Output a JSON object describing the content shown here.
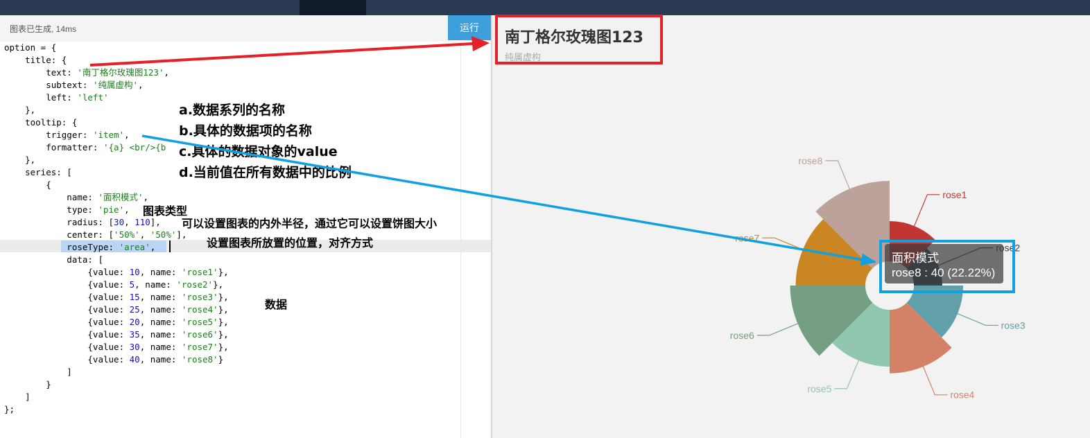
{
  "status": {
    "message": "图表已生成, 14ms"
  },
  "toolbar": {
    "run_label": "运行"
  },
  "code_lines": [
    [
      {
        "t": "option = {"
      }
    ],
    [
      {
        "t": "    title: {"
      }
    ],
    [
      {
        "t": "        text: "
      },
      {
        "t": "'南丁格尔玫瑰图123'",
        "c": "s"
      },
      {
        "t": ","
      }
    ],
    [
      {
        "t": "        subtext: "
      },
      {
        "t": "'纯属虚构'",
        "c": "s"
      },
      {
        "t": ","
      }
    ],
    [
      {
        "t": "        left: "
      },
      {
        "t": "'left'",
        "c": "s"
      }
    ],
    [
      {
        "t": "    },"
      }
    ],
    [
      {
        "t": "    tooltip: {"
      }
    ],
    [
      {
        "t": "        trigger: "
      },
      {
        "t": "'item'",
        "c": "s"
      },
      {
        "t": ","
      }
    ],
    [
      {
        "t": "        formatter: "
      },
      {
        "t": "'{a} <br/>{b",
        "c": "s"
      }
    ],
    [
      {
        "t": "    },"
      }
    ],
    [
      {
        "t": "    series: ["
      }
    ],
    [
      {
        "t": "        {"
      }
    ],
    [
      {
        "t": "            name: "
      },
      {
        "t": "'面积模式'",
        "c": "s"
      },
      {
        "t": ","
      }
    ],
    [
      {
        "t": "            type: "
      },
      {
        "t": "'pie'",
        "c": "s"
      },
      {
        "t": ","
      }
    ],
    [
      {
        "t": "            radius: ["
      },
      {
        "t": "30",
        "c": "n"
      },
      {
        "t": ", "
      },
      {
        "t": "110",
        "c": "n"
      },
      {
        "t": "],"
      }
    ],
    [
      {
        "t": "            center: ["
      },
      {
        "t": "'50%'",
        "c": "s"
      },
      {
        "t": ", "
      },
      {
        "t": "'50%'",
        "c": "s"
      },
      {
        "t": "],"
      }
    ],
    [
      {
        "t": "            roseType: "
      },
      {
        "t": "'area'",
        "c": "s"
      },
      {
        "t": ","
      }
    ],
    [
      {
        "t": "            data: ["
      }
    ],
    [
      {
        "t": "                {value: "
      },
      {
        "t": "10",
        "c": "n"
      },
      {
        "t": ", name: "
      },
      {
        "t": "'rose1'",
        "c": "s"
      },
      {
        "t": "},"
      }
    ],
    [
      {
        "t": "                {value: "
      },
      {
        "t": "5",
        "c": "n"
      },
      {
        "t": ", name: "
      },
      {
        "t": "'rose2'",
        "c": "s"
      },
      {
        "t": "},"
      }
    ],
    [
      {
        "t": "                {value: "
      },
      {
        "t": "15",
        "c": "n"
      },
      {
        "t": ", name: "
      },
      {
        "t": "'rose3'",
        "c": "s"
      },
      {
        "t": "},"
      }
    ],
    [
      {
        "t": "                {value: "
      },
      {
        "t": "25",
        "c": "n"
      },
      {
        "t": ", name: "
      },
      {
        "t": "'rose4'",
        "c": "s"
      },
      {
        "t": "},"
      }
    ],
    [
      {
        "t": "                {value: "
      },
      {
        "t": "20",
        "c": "n"
      },
      {
        "t": ", name: "
      },
      {
        "t": "'rose5'",
        "c": "s"
      },
      {
        "t": "},"
      }
    ],
    [
      {
        "t": "                {value: "
      },
      {
        "t": "35",
        "c": "n"
      },
      {
        "t": ", name: "
      },
      {
        "t": "'rose6'",
        "c": "s"
      },
      {
        "t": "},"
      }
    ],
    [
      {
        "t": "                {value: "
      },
      {
        "t": "30",
        "c": "n"
      },
      {
        "t": ", name: "
      },
      {
        "t": "'rose7'",
        "c": "s"
      },
      {
        "t": "},"
      }
    ],
    [
      {
        "t": "                {value: "
      },
      {
        "t": "40",
        "c": "n"
      },
      {
        "t": ", name: "
      },
      {
        "t": "'rose8'",
        "c": "s"
      },
      {
        "t": "}"
      }
    ],
    [
      {
        "t": "            ]"
      }
    ],
    [
      {
        "t": "        }"
      }
    ],
    [
      {
        "t": "    ]"
      }
    ],
    [
      {
        "t": "};"
      }
    ]
  ],
  "annotations": {
    "a": "a.数据系列的名称",
    "b": "b.具体的数据项的名称",
    "c": "c.具体的数据对象的value",
    "d": "d.当前值在所有数据中的比例",
    "type": "图表类型",
    "radius": "可以设置图表的内外半径，通过它可以设置饼图大小",
    "center": "设置图表所放置的位置，对齐方式",
    "data": "数据"
  },
  "preview": {
    "title": "南丁格尔玫瑰图123",
    "subtitle": "纯属虚构"
  },
  "tooltip": {
    "series": "面积模式",
    "item": "rose8 : 40 (22.22%)"
  },
  "chart_data": {
    "type": "pie",
    "rose_type": "area",
    "series_name": "面积模式",
    "categories": [
      "rose1",
      "rose2",
      "rose3",
      "rose4",
      "rose5",
      "rose6",
      "rose7",
      "rose8"
    ],
    "values": [
      10,
      5,
      15,
      25,
      20,
      35,
      30,
      40
    ],
    "colors": [
      "#c23531",
      "#2f4554",
      "#61a0a8",
      "#d48265",
      "#91c7ae",
      "#749f83",
      "#ca8622",
      "#bda29a"
    ]
  },
  "colors": {
    "red_highlight": "#e4202a",
    "blue_highlight": "#11a0e0",
    "run_button": "#3da0dc"
  }
}
